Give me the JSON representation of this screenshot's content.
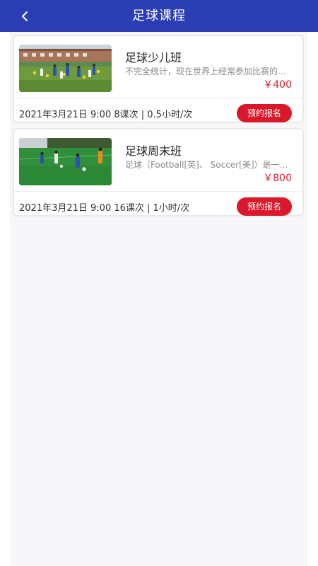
{
  "header": {
    "back_icon": "chevron-left-icon",
    "title": "足球课程",
    "bg_color": "#2a3db3"
  },
  "courses": [
    {
      "image": "kids-soccer-training-photo",
      "title": "足球少儿班",
      "description": "不完全统计，现在世界上经常参加比赛的足球…",
      "price": "￥400",
      "meta": "2021年3月21日 9:00    8课次 | 0.5小时/次",
      "button": "预约报名"
    },
    {
      "image": "kids-playing-soccer-photo",
      "title": "足球周末班",
      "description": "足球（Football[英]、 Soccer[美]）是一项…",
      "price": "￥800",
      "meta": "2021年3月21日 9:00    16课次 | 1小时/次",
      "button": "预约报名"
    }
  ],
  "colors": {
    "accent_red": "#d9192b",
    "price_red": "#d81e2c"
  }
}
